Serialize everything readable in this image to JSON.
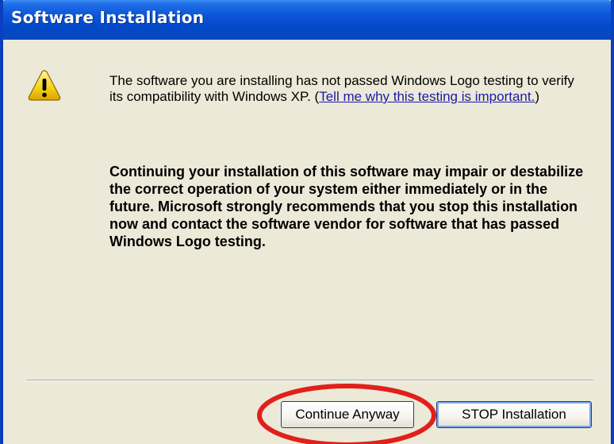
{
  "window": {
    "title": "Software Installation"
  },
  "icons": {
    "warning": "warning-triangle-icon"
  },
  "message": {
    "text_before_link": "The software you are installing has not passed Windows Logo testing to verify its compatibility with Windows XP. (",
    "link_text": "Tell me why this testing is important.",
    "text_after_link": ")"
  },
  "warning_text": "Continuing your installation of this software may impair or destabilize the correct operation of your system either immediately or in the future. Microsoft strongly recommends that you stop this installation now and contact the software vendor for software that has passed Windows Logo testing.",
  "buttons": {
    "continue": "Continue Anyway",
    "stop": "STOP Installation"
  },
  "colors": {
    "titlebar": "#0a55d6",
    "dialog_background": "#ece9d8",
    "link": "#1a1aa6",
    "highlight": "#e0201a",
    "warning_yellow": "#f7d51c"
  }
}
